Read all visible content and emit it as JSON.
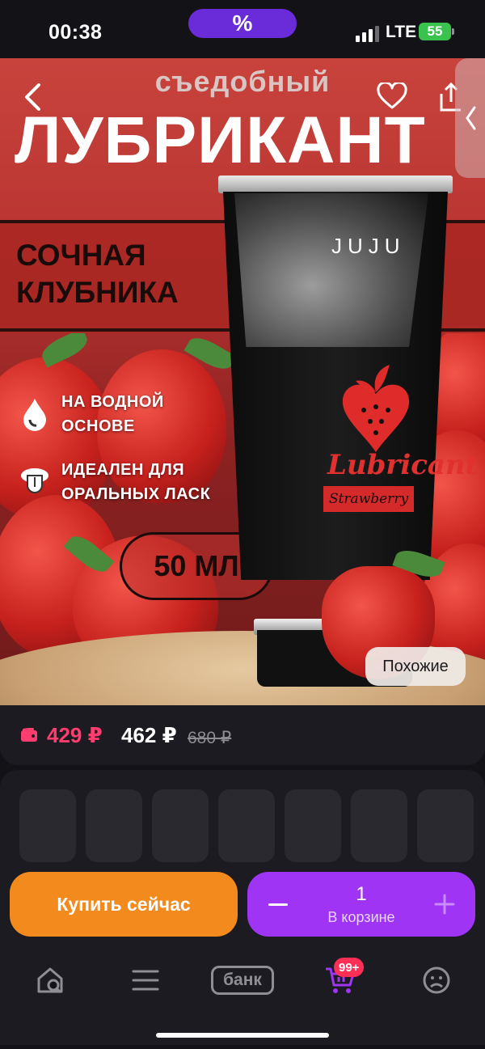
{
  "status_bar": {
    "time": "00:38",
    "promo_symbol": "%",
    "network": "LTE",
    "battery": "55"
  },
  "product_image": {
    "headline_small": "съедобный",
    "headline_big": "ЛУБРИКАНТ",
    "taste_line1": "СОЧНАЯ",
    "taste_line2": "КЛУБНИКА",
    "feature1_line1": "НА ВОДНОЙ",
    "feature1_line2": "ОСНОВЕ",
    "feature2_line1": "ИДЕАЛЕН ДЛЯ",
    "feature2_line2": "ОРАЛЬНЫХ ЛАСК",
    "volume": "50 МЛ",
    "tube_brand": "JUJU",
    "tube_product": "Lubricant",
    "tube_flavor": "Strawberry",
    "similar_label": "Похожие"
  },
  "price": {
    "card_price": "429 ₽",
    "current_price": "462 ₽",
    "old_price": "680 ₽",
    "accent_color": "#ff3d6e"
  },
  "actions": {
    "buy_now_label": "Купить сейчас",
    "cart_quantity": "1",
    "cart_label": "В корзине",
    "buy_color": "#f28a1d",
    "cart_color": "#a034f5"
  },
  "tab_bar": {
    "items": [
      {
        "name": "home-search",
        "icon": "home-search-icon"
      },
      {
        "name": "catalog",
        "icon": "menu-icon"
      },
      {
        "name": "bank",
        "label": "банк"
      },
      {
        "name": "cart",
        "icon": "cart-icon",
        "badge": "99+"
      },
      {
        "name": "profile",
        "icon": "profile-icon"
      }
    ]
  }
}
